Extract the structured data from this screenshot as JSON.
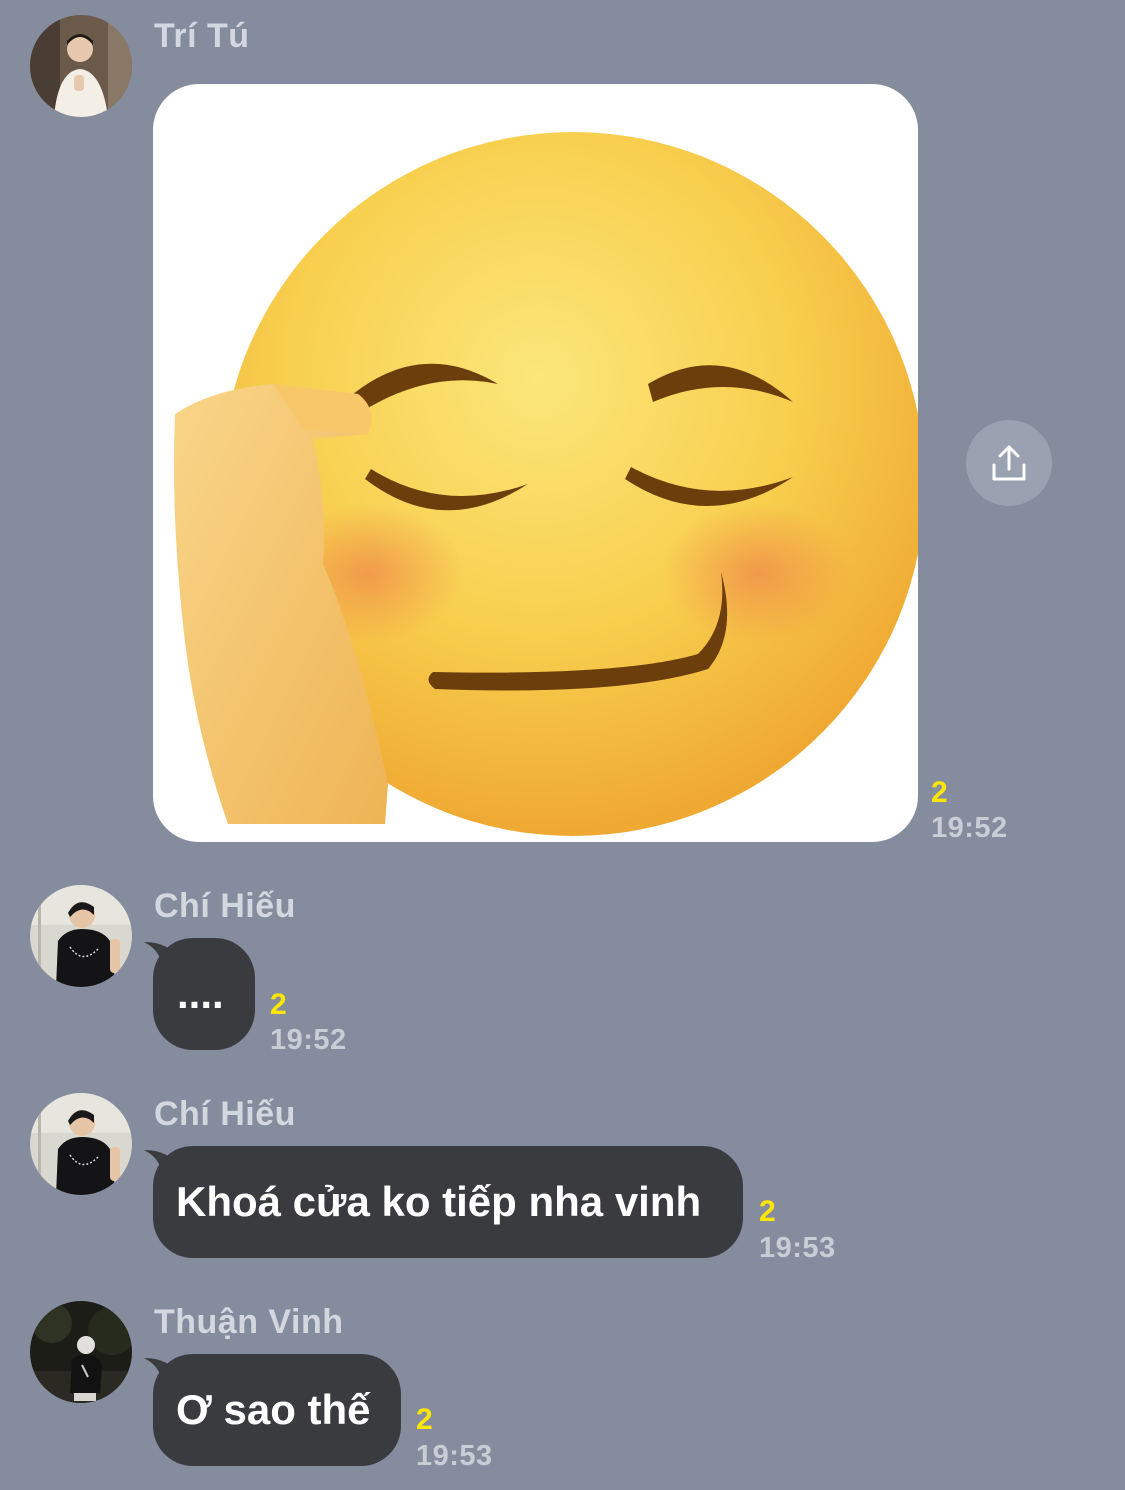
{
  "messages": [
    {
      "sender": "Trí Tú",
      "type": "sticker",
      "sticker_icon": "smirk-salute-emoji-icon",
      "read_count": "2",
      "time": "19:52"
    },
    {
      "sender": "Chí Hiếu",
      "type": "text",
      "text": "....",
      "read_count": "2",
      "time": "19:52"
    },
    {
      "sender": "Chí Hiếu",
      "type": "text",
      "text": "Khoá cửa ko tiếp nha vinh",
      "read_count": "2",
      "time": "19:53"
    },
    {
      "sender": "Thuận Vinh",
      "type": "text",
      "text": "Ơ sao thế",
      "read_count": "2",
      "time": "19:53"
    }
  ],
  "colors": {
    "background": "#848c9e",
    "bubble": "#3a3b3f",
    "read_count": "#ffe600",
    "sender_name": "#d3d7e0"
  }
}
